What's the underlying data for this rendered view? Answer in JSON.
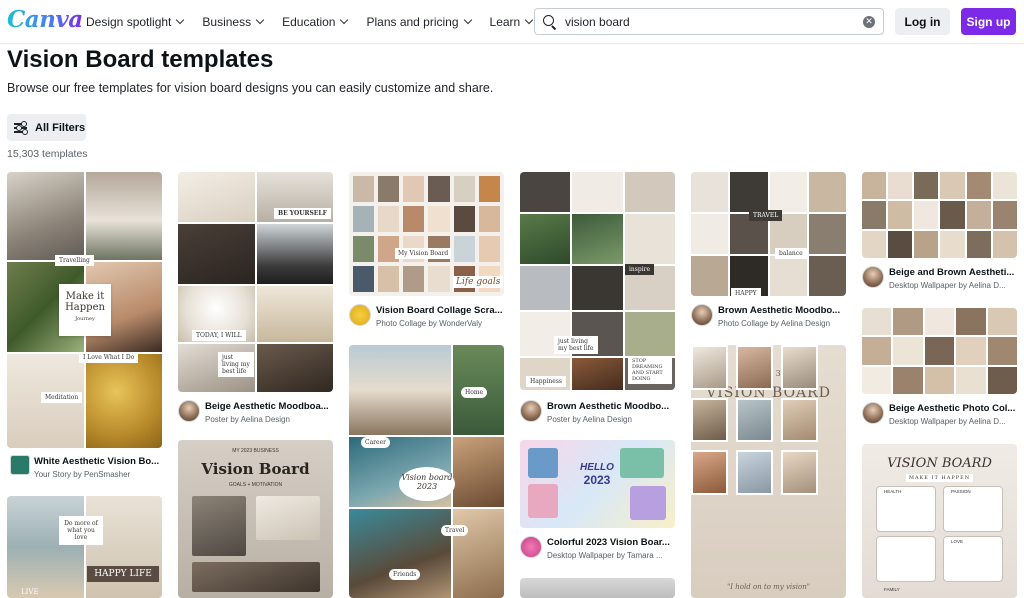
{
  "brand": {
    "logo_text": "Canva",
    "accent": "#7d2ae8",
    "logo_gradient": [
      "#19bfd8",
      "#7d2ae8"
    ]
  },
  "nav": [
    {
      "label": "Design spotlight"
    },
    {
      "label": "Business"
    },
    {
      "label": "Education"
    },
    {
      "label": "Plans and pricing"
    },
    {
      "label": "Learn"
    }
  ],
  "search": {
    "value": "vision board",
    "icon": "search-icon",
    "clear_icon": "clear-icon"
  },
  "auth": {
    "login_label": "Log in",
    "signup_label": "Sign up"
  },
  "page": {
    "title": "Vision Board templates",
    "subtitle": "Browse our free templates for vision board designs you can easily customize and share.",
    "filters_label": "All Filters",
    "count": "15,303 templates"
  },
  "cards": [
    {
      "title": "White Aesthetic Vision Bo...",
      "subtitle": "Your Story by PenSmasher",
      "overlay": [
        "Make it",
        "Happen",
        "Journey"
      ],
      "tags": [
        "Travelling",
        "I Love What I Do",
        "Meditation"
      ]
    },
    {
      "title": "Beige Aesthetic Moodboa...",
      "subtitle": "Poster by Aelina Design",
      "tags": [
        "BE YOURSELF",
        "TODAY, I WILL",
        "just living my best life"
      ]
    },
    {
      "title": "Vision Board Collage Scra...",
      "subtitle": "Photo Collage by WonderValy",
      "overlay": [
        "My Vision Board",
        "Life goals"
      ]
    },
    {
      "title": "Brown Aesthetic Moodbo...",
      "subtitle": "Poster by Aelina Design",
      "tags": [
        "inspire",
        "just living my best life",
        "STOP DREAMING AND START DOING",
        "Happiness"
      ]
    },
    {
      "title": "Brown Aesthetic Moodbo...",
      "subtitle": "Photo Collage by Aelina Design",
      "tags": [
        "TRAVEL",
        "HAPPY",
        "balance"
      ]
    },
    {
      "title": "Beige and Brown Aestheti...",
      "subtitle": "Desktop Wallpaper by Aelina D..."
    },
    {
      "title": "Beige Aesthetic Photo Col...",
      "subtitle": "Desktop Wallpaper by Aelina D..."
    },
    {
      "title": "Colorful 2023 Vision Boar...",
      "subtitle": "Desktop Wallpaper by Tamara ...",
      "overlay": [
        "HELLO",
        "2023"
      ]
    },
    {
      "overlay": [
        "MY 2023 BUSINESS",
        "Vision Board",
        "GOALS + MOTIVATION"
      ]
    },
    {
      "overlay": [
        "Vision board",
        "2023"
      ],
      "tags": [
        "Home",
        "Career",
        "Travel",
        "Friends"
      ]
    },
    {
      "overlay": [
        "2023",
        "VISION BOARD",
        "\"I hold on to my vision\""
      ]
    },
    {
      "overlay": [
        "VISION BOARD",
        "MAKE IT HAPPEN"
      ],
      "tags": [
        "HEALTH",
        "PASSION",
        "LOVE",
        "FAMILY"
      ]
    },
    {
      "overlay": [
        "Do more of what you love",
        "HAPPY LIFE",
        "LIVE"
      ]
    }
  ]
}
